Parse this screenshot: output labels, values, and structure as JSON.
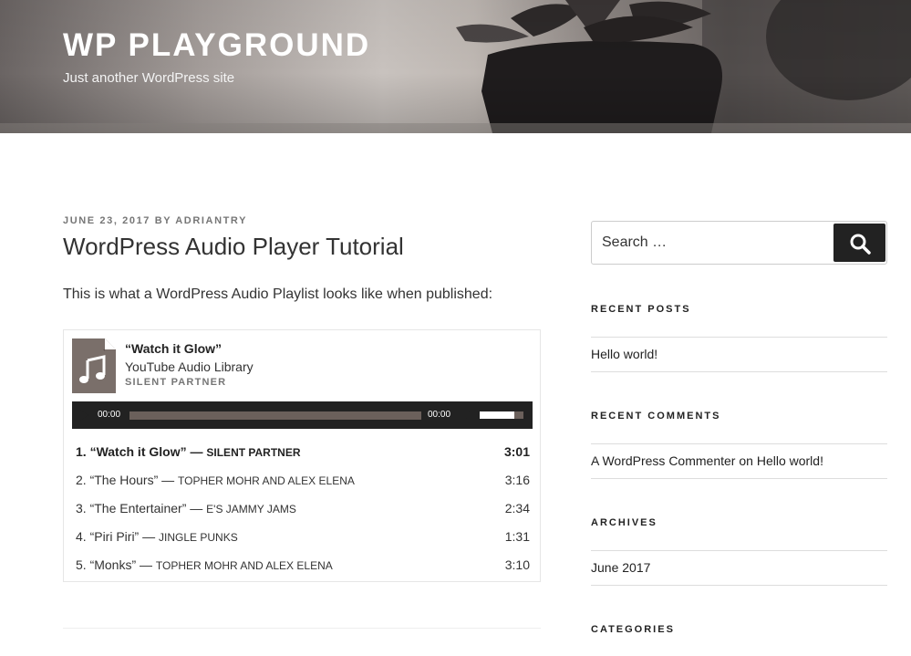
{
  "site": {
    "title": "WP PLAYGROUND",
    "tagline": "Just another WordPress site"
  },
  "post": {
    "date": "JUNE 23, 2017",
    "by": "BY",
    "author": "ADRIANTRY",
    "title": "WordPress Audio Player Tutorial",
    "intro": "This is what a WordPress Audio Playlist looks like when published:"
  },
  "playlist": {
    "current": {
      "title": "“Watch it Glow”",
      "album": "YouTube Audio Library",
      "artist": "SILENT PARTNER",
      "icon": "music-note-icon"
    },
    "player": {
      "current_time": "00:00",
      "total_time": "00:00",
      "progress": 0,
      "volume": 0.8
    },
    "tracks": [
      {
        "label": "1. “Watch it Glow”",
        "sep": "—",
        "artist": "SILENT PARTNER",
        "length": "3:01",
        "active": true
      },
      {
        "label": "2. “The Hours”",
        "sep": "—",
        "artist": "TOPHER MOHR AND ALEX ELENA",
        "length": "3:16",
        "active": false
      },
      {
        "label": "3. “The Entertainer”",
        "sep": "—",
        "artist": "E'S JAMMY JAMS",
        "length": "2:34",
        "active": false
      },
      {
        "label": "4. “Piri Piri”",
        "sep": "—",
        "artist": "JINGLE PUNKS",
        "length": "1:31",
        "active": false
      },
      {
        "label": "5. “Monks”",
        "sep": "—",
        "artist": "TOPHER MOHR AND ALEX ELENA",
        "length": "3:10",
        "active": false
      }
    ]
  },
  "sidebar": {
    "search": {
      "placeholder": "Search …",
      "icon": "search-icon"
    },
    "recent_posts": {
      "title": "RECENT POSTS",
      "items": [
        "Hello world!"
      ]
    },
    "recent_comments": {
      "title": "RECENT COMMENTS",
      "author": "A WordPress Commenter",
      "on": "on",
      "post": "Hello world!"
    },
    "archives": {
      "title": "ARCHIVES",
      "items": [
        "June 2017"
      ]
    },
    "categories": {
      "title": "CATEGORIES"
    }
  },
  "colors": {
    "player_bg": "#222222",
    "rail": "#6b605b",
    "art_bg": "#7a6f6a"
  }
}
